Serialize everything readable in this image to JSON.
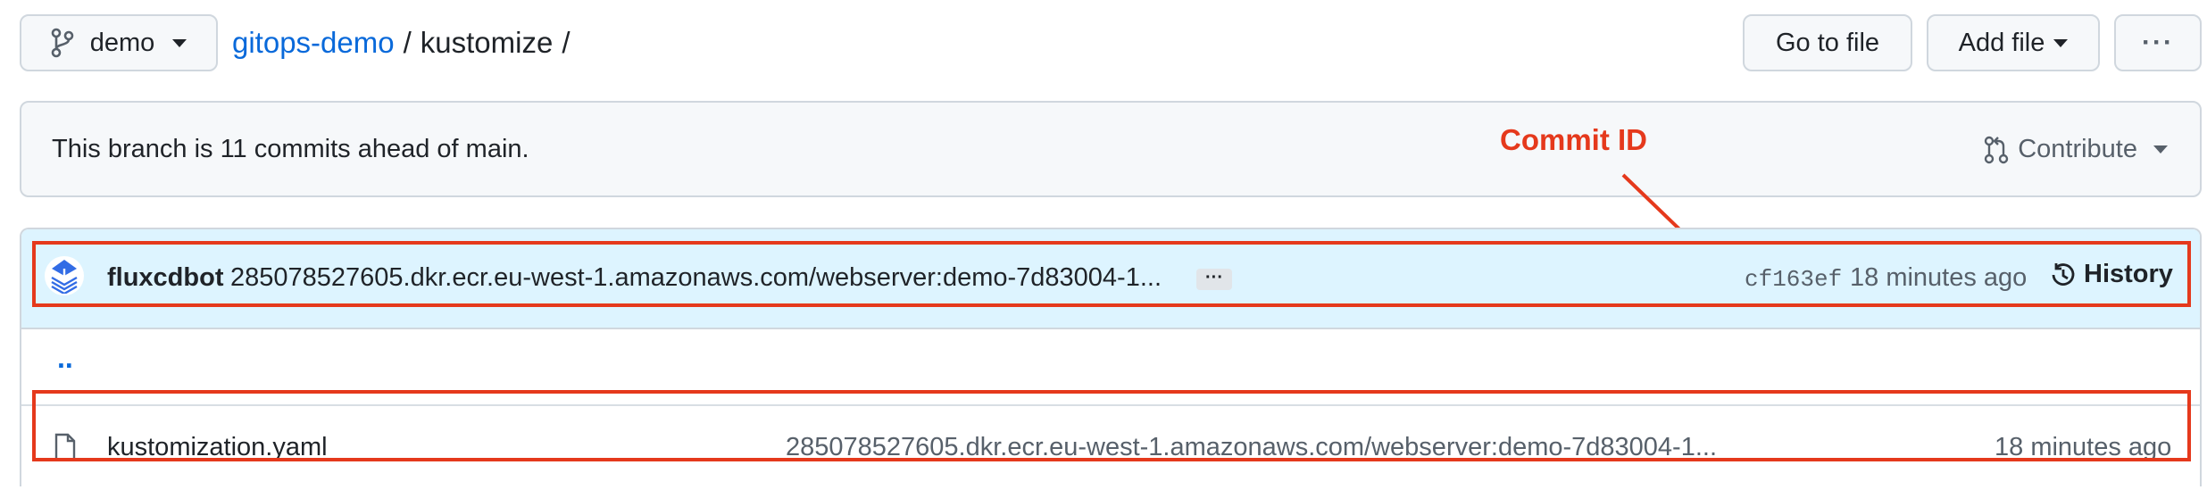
{
  "toolbar": {
    "branch_label": "demo",
    "repo_link": "gitops-demo",
    "separator1": "/",
    "folder": "kustomize",
    "separator2": "/",
    "go_to_file": "Go to file",
    "add_file": "Add file",
    "more_label": "···"
  },
  "notice": {
    "text": "This branch is 11 commits ahead of main.",
    "contribute": "Contribute"
  },
  "commit": {
    "author": "fluxcdbot",
    "message": "285078527605.dkr.ecr.eu-west-1.amazonaws.com/webserver:demo-7d83004-1...",
    "expand": "···",
    "sha": "cf163ef",
    "time": "18 minutes ago",
    "history": "History"
  },
  "annotation": {
    "label": "Commit ID",
    "color": "#e5391c"
  },
  "files": {
    "parent": "..",
    "rows": [
      {
        "name": "kustomization.yaml",
        "message": "285078527605.dkr.ecr.eu-west-1.amazonaws.com/webserver:demo-7d83004-1...",
        "time": "18 minutes ago"
      }
    ]
  },
  "colors": {
    "link": "#0969da",
    "highlight": "#e5391c",
    "commit_bar": "#ddf4ff"
  }
}
